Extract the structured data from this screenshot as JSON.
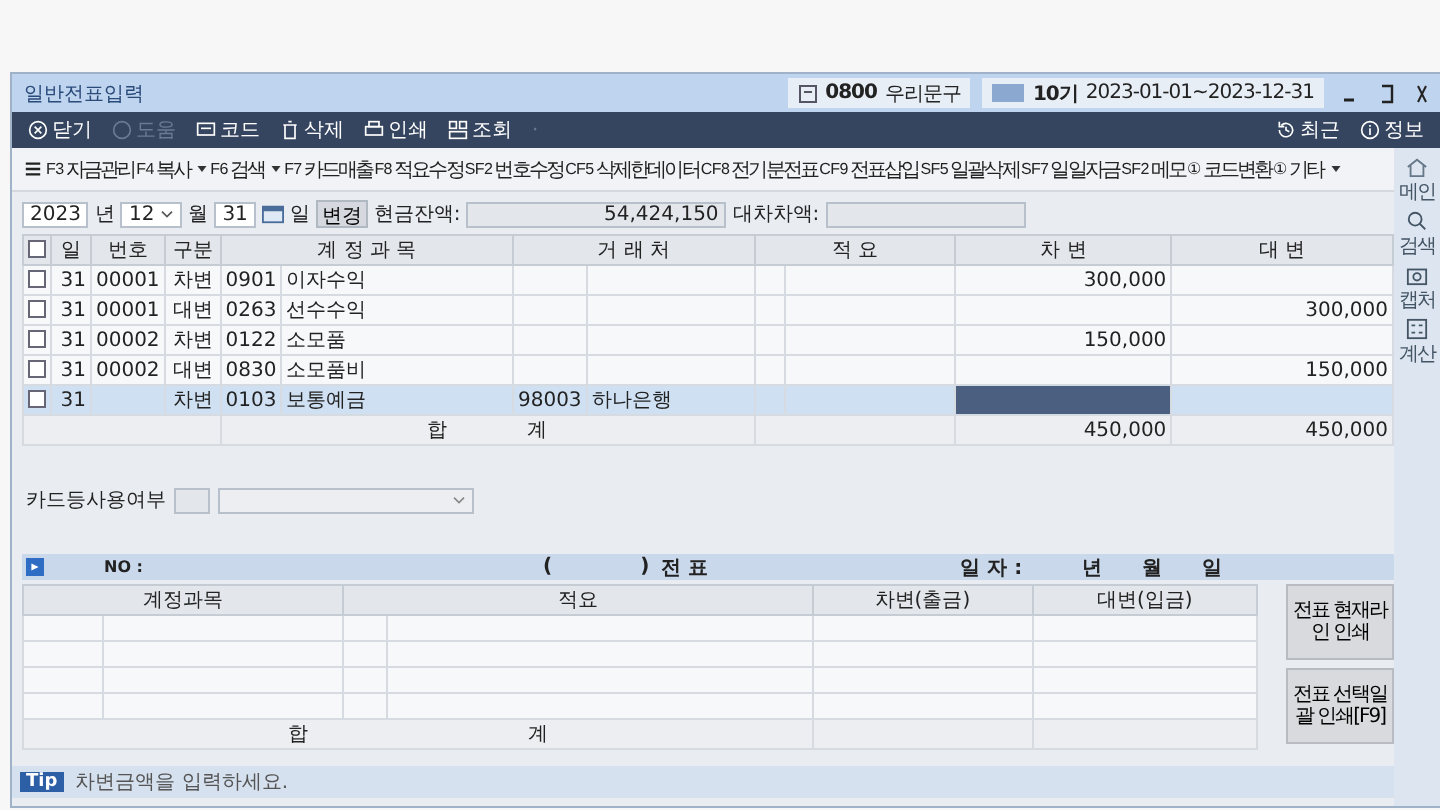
{
  "window": {
    "title": "일반전표입력",
    "company_code": "0800",
    "company_name": "우리문구",
    "term": "10기",
    "period": "2023-01-01~2023-12-31"
  },
  "toolbar": [
    {
      "label": "닫기",
      "disabled": false
    },
    {
      "label": "도움",
      "disabled": true
    },
    {
      "label": "코드",
      "disabled": false
    },
    {
      "label": "삭제",
      "disabled": false
    },
    {
      "label": "인쇄",
      "disabled": false
    },
    {
      "label": "조회",
      "disabled": false
    },
    {
      "label": "·",
      "disabled": true
    }
  ],
  "toolbar_right": [
    {
      "label": "최근"
    },
    {
      "label": "정보"
    }
  ],
  "function_keys": [
    {
      "key": "F3",
      "label": "자금관리",
      "dropdown": false
    },
    {
      "key": "F4",
      "label": "복사",
      "dropdown": true
    },
    {
      "key": "F6",
      "label": "검색",
      "dropdown": true
    },
    {
      "key": "F7",
      "label": "카드매출",
      "dropdown": false
    },
    {
      "key": "F8",
      "label": "적요수정",
      "dropdown": false
    },
    {
      "key": "SF2",
      "label": "번호수정",
      "dropdown": false
    },
    {
      "key": "CF5",
      "label": "삭제한데이터",
      "dropdown": false
    },
    {
      "key": "CF8",
      "label": "전기분전표",
      "dropdown": false
    },
    {
      "key": "CF9",
      "label": "전표삽입",
      "dropdown": false
    },
    {
      "key": "SF5",
      "label": "일괄삭제",
      "dropdown": false
    },
    {
      "key": "SF7",
      "label": "일일자금",
      "dropdown": false
    },
    {
      "key": "SF2",
      "label": "메모",
      "dropdown": false
    },
    {
      "key": "①",
      "label": "코드변환",
      "dropdown": false
    },
    {
      "key": "①",
      "label": "기타",
      "dropdown": true
    }
  ],
  "date_bar": {
    "year": "2023",
    "year_unit": "년",
    "month": "12",
    "month_unit": "월",
    "day": "31",
    "day_unit": "일",
    "change_button": "변경",
    "cash_label": "현금잔액:",
    "cash_value": "54,424,150",
    "diff_label": "대차차액:"
  },
  "journal": {
    "columns": [
      "일",
      "번호",
      "구분",
      "계 정 과 목",
      "거 래 처",
      "적 요",
      "차 변",
      "대 변"
    ],
    "all_checked": false,
    "rows": [
      {
        "checked": false,
        "selected": false,
        "editing": false,
        "day": "31",
        "number": "00001",
        "type": "차변",
        "account_code": "0901",
        "account_name": "이자수익",
        "debit": "300,000"
      },
      {
        "checked": false,
        "selected": false,
        "editing": false,
        "day": "31",
        "number": "00001",
        "type": "대변",
        "account_code": "0263",
        "account_name": "선수수익",
        "credit": "300,000"
      },
      {
        "checked": false,
        "selected": false,
        "editing": false,
        "day": "31",
        "number": "00002",
        "type": "차변",
        "account_code": "0122",
        "account_name": "소모품",
        "debit": "150,000"
      },
      {
        "checked": false,
        "selected": false,
        "editing": false,
        "day": "31",
        "number": "00002",
        "type": "대변",
        "account_code": "0830",
        "account_name": "소모품비",
        "credit": "150,000"
      },
      {
        "checked": false,
        "selected": true,
        "editing": true,
        "day": "31",
        "type": "차변",
        "account_code": "0103",
        "account_name": "보통예금",
        "partner_code": "98003",
        "partner_name": "하나은행"
      }
    ],
    "total": {
      "label_1": "합",
      "label_2": "계",
      "debit": "450,000",
      "credit": "450,000"
    }
  },
  "card": {
    "label": "카드등사용여부"
  },
  "voucher": {
    "no_label": "NO :",
    "title_open": "(",
    "title_close": ")",
    "title": "전 표",
    "date_label": "일 자 :",
    "year": "년",
    "month": "월",
    "day": "일",
    "columns": [
      "계정과목",
      "적요",
      "차변(출금)",
      "대변(입금)"
    ],
    "total_1": "합",
    "total_2": "계",
    "buttons": [
      "전표 현재라인 인쇄",
      "전표 선택일괄 인쇄[F9]"
    ]
  },
  "tip": {
    "badge": "Tip",
    "text": "차변금액을 입력하세요."
  },
  "sidebar": [
    {
      "label": "메인"
    },
    {
      "label": "검색"
    },
    {
      "label": "캡처"
    },
    {
      "label": "계산"
    }
  ]
}
